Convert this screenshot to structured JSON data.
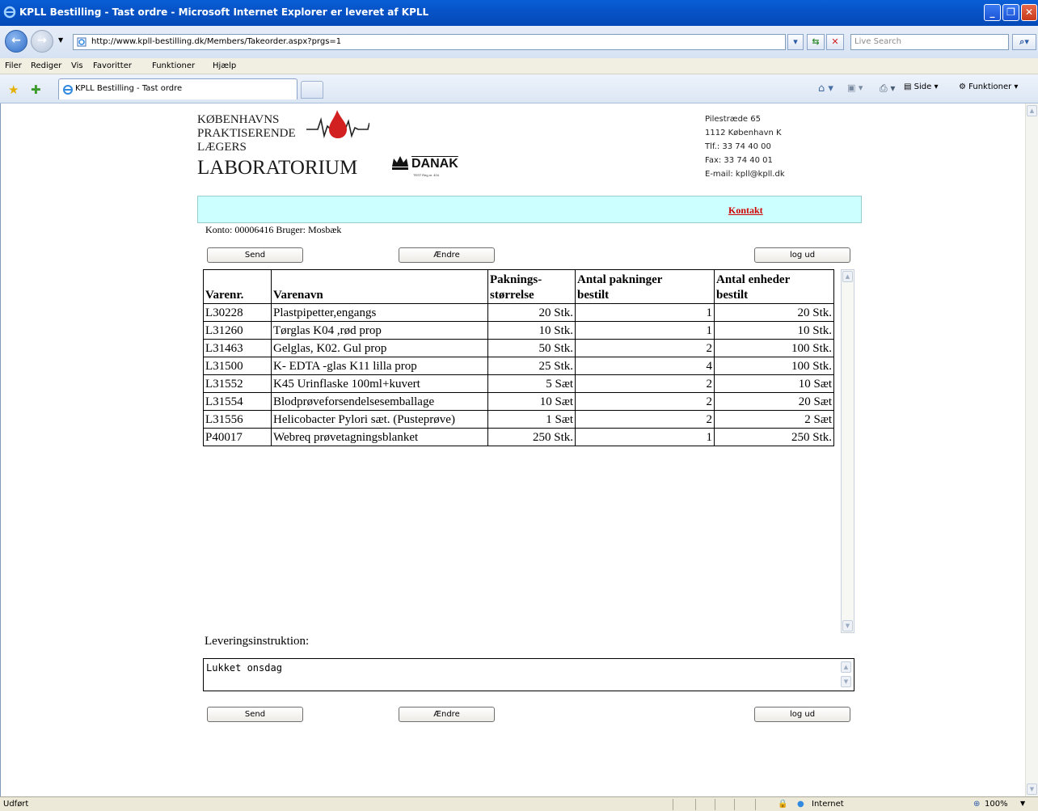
{
  "window": {
    "title": "KPLL Bestilling - Tast ordre - Microsoft Internet Explorer er leveret af KPLL"
  },
  "address_bar": {
    "url": "http://www.kpll-bestilling.dk/Members/Takeorder.aspx?prgs=1",
    "search_placeholder": "Live Search"
  },
  "menu": {
    "items": [
      "Filer",
      "Rediger",
      "Vis",
      "Favoritter",
      "Funktioner",
      "Hjælp"
    ]
  },
  "tabs": {
    "active_tab": "KPLL Bestilling - Tast ordre"
  },
  "toolbar": {
    "side_label": "Side",
    "funktioner_label": "Funktioner"
  },
  "logo": {
    "line1": "KØBENHAVNS",
    "line2": "PRAKTISERENDE",
    "line3": "LÆGERS",
    "line4": "LABORATORIUM",
    "danak": "DANAK",
    "danak_sub": "TEST Reg.nr. 404"
  },
  "contact": {
    "street": "Pilestræde 65",
    "city": "1112 København K",
    "phone": "Tlf.: 33 74 40 00",
    "fax": "Fax: 33 74 40 01",
    "email": "E-mail: kpll@kpll.dk"
  },
  "nav": {
    "kontakt": "Kontakt"
  },
  "account": {
    "line": "Konto: 00006416 Bruger: Mosbæk"
  },
  "buttons": {
    "send": "Send",
    "aendre": "Ændre",
    "logud": "log ud"
  },
  "table": {
    "headers": {
      "varenr": "Varenr.",
      "varenavn": "Varenavn",
      "pakning_1": "Paknings-",
      "pakning_2": "størrelse",
      "antal_pak_1": "Antal pakninger",
      "antal_pak_2": "bestilt",
      "antal_enh_1": "Antal enheder",
      "antal_enh_2": "bestilt"
    },
    "rows": [
      {
        "varenr": "L30228",
        "varenavn": "Plastpipetter,engangs",
        "pakning": "20 Stk.",
        "antal_pak": "1",
        "antal_enh": "20 Stk."
      },
      {
        "varenr": "L31260",
        "varenavn": "Tørglas K04 ,rød prop",
        "pakning": "10 Stk.",
        "antal_pak": "1",
        "antal_enh": "10 Stk."
      },
      {
        "varenr": "L31463",
        "varenavn": "Gelglas, K02. Gul prop",
        "pakning": "50 Stk.",
        "antal_pak": "2",
        "antal_enh": "100 Stk."
      },
      {
        "varenr": "L31500",
        "varenavn": "K- EDTA -glas K11 lilla prop",
        "pakning": "25 Stk.",
        "antal_pak": "4",
        "antal_enh": "100 Stk."
      },
      {
        "varenr": "L31552",
        "varenavn": "K45 Urinflaske 100ml+kuvert",
        "pakning": "5 Sæt",
        "antal_pak": "2",
        "antal_enh": "10 Sæt"
      },
      {
        "varenr": "L31554",
        "varenavn": "Blodprøveforsendelsesemballage",
        "pakning": "10 Sæt",
        "antal_pak": "2",
        "antal_enh": "20 Sæt"
      },
      {
        "varenr": "L31556",
        "varenavn": "Helicobacter Pylori sæt. (Pusteprøve)",
        "pakning": "1 Sæt",
        "antal_pak": "2",
        "antal_enh": "2 Sæt"
      },
      {
        "varenr": "P40017",
        "varenavn": "Webreq prøvetagningsblanket",
        "pakning": "250 Stk.",
        "antal_pak": "1",
        "antal_enh": "250 Stk."
      }
    ]
  },
  "delivery": {
    "label": "Leveringsinstruktion:",
    "value": "Lukket onsdag"
  },
  "statusbar": {
    "status": "Udført",
    "zone": "Internet",
    "zoom": "100%"
  },
  "colors": {
    "cyan_bar": "#ccffff",
    "kontakt_link": "#d00000",
    "logo_drop": "#d21f1f",
    "title_bar": "#0653c7"
  }
}
